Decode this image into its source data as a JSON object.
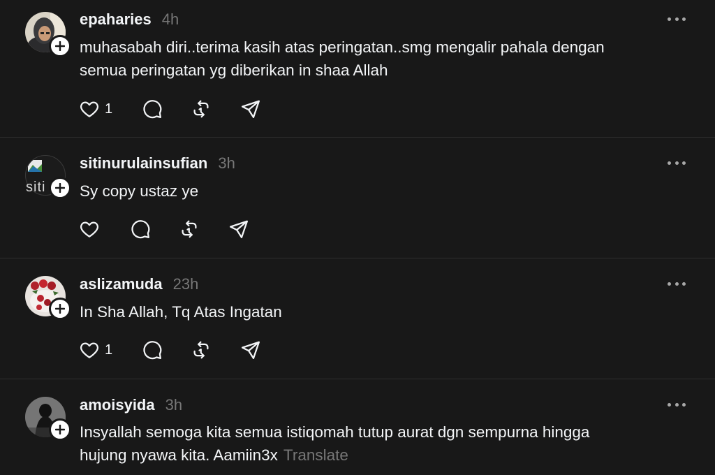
{
  "colors": {
    "background": "#181818",
    "text_primary": "#f3f5f7",
    "text_secondary": "#777777",
    "divider": "#2e2e2e"
  },
  "posts": [
    {
      "username": "epaharies",
      "time": "4h",
      "lines": [
        "muhasabah diri..terima kasih atas peringatan..smg mengalir pahala dengan",
        "semua peringatan yg diberikan in shaa Allah"
      ],
      "like_count": "1",
      "avatar_icon": "user-photo-avatar"
    },
    {
      "username": "sitinurulainsufian",
      "time": "3h",
      "lines": [
        "Sy copy ustaz ye"
      ],
      "like_count": "",
      "avatar_icon": "broken-image-avatar",
      "avatar_alt_text": "siti"
    },
    {
      "username": "aslizamuda",
      "time": "23h",
      "lines": [
        "In Sha Allah, Tq Atas Ingatan"
      ],
      "like_count": "1",
      "avatar_icon": "roses-photo-avatar"
    },
    {
      "username": "amoisyida",
      "time": "3h",
      "lines": [
        "Insyallah semoga kita semua istiqomah tutup aurat dgn sempurna hingga",
        "hujung nyawa kita. Aamiin3x"
      ],
      "translate_label": "Translate",
      "avatar_icon": "silhouette-photo-avatar"
    }
  ],
  "icons": {
    "like": "heart-icon",
    "reply": "comment-bubble-icon",
    "repost": "repost-icon",
    "share": "send-icon",
    "more": "more-dots-icon",
    "follow": "plus-icon"
  }
}
